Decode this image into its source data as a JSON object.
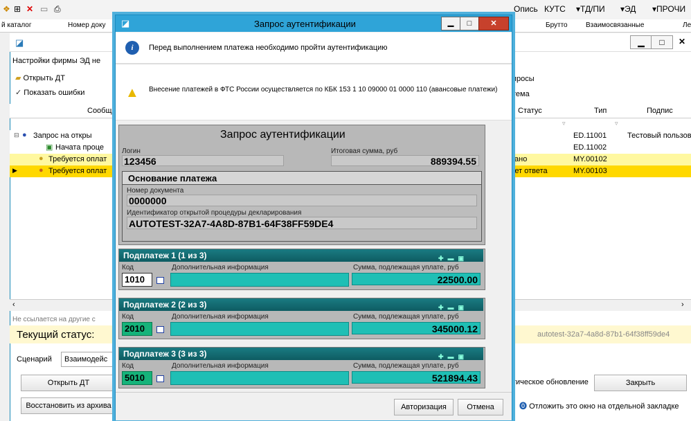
{
  "app": {
    "toolbar_items": [
      "Опись",
      "КУТС",
      "▾ТД/ПИ",
      "▾ЭД",
      "▾ПРОЧИ"
    ],
    "column_headers": [
      "й каталог",
      "Номер доку",
      "Брутто",
      "Взаимосвязанные",
      "Ле"
    ],
    "settings_label": "Настройки фирмы ЭД не",
    "actions": [
      "Открыть ДТ",
      "Показать ошибки"
    ],
    "right_actions": [
      "просы",
      "тема"
    ],
    "tree_header": "Сообщ",
    "grid_headers": [
      "Статус",
      "Тип",
      "Подпис"
    ],
    "tree_rows": [
      "Запрос на откры",
      "Начата проце",
      "Требуется оплат",
      "Требуется оплат"
    ],
    "grid_rows": [
      {
        "status": "",
        "type": "ED.11001",
        "sign": "Тестовый пользов"
      },
      {
        "status": "",
        "type": "ED.11002",
        "sign": ""
      },
      {
        "status": "зано",
        "type": "MY.00102",
        "sign": ""
      },
      {
        "status": "ует ответа",
        "type": "MY.00103",
        "sign": ""
      }
    ],
    "links_note": "Не ссылается на другие с",
    "current_status_label": "Текущий статус:",
    "current_status_value": "autotest-32a7-4a8d-87b1-64f38ff59de4",
    "scenario_label": "Сценарий",
    "scenario_value": "Взаимодейс",
    "open_dt_button": "Открыть ДТ",
    "auto_update_label": "тическое обновление",
    "close_button": "Закрыть",
    "restore_button": "Восстановить из архива",
    "defer_label": "Отложить это окно на отдельной закладке"
  },
  "dialog": {
    "title": "Запрос аутентификации",
    "info_message": "Перед выполнением платежа необходимо пройти аутентификацию",
    "warning_message": "Внесение платежей в ФТС России осуществляется по КБК 153 1 10 09000 01 0000 110 (авансовые платежи)",
    "panel_title": "Запрос аутентификации",
    "login_label": "Логин",
    "login_value": "123456",
    "total_label": "Итоговая сумма, руб",
    "total_value": "889394.55",
    "basis_title": "Основание платежа",
    "doc_number_label": "Номер документа",
    "doc_number_value": "0000000",
    "procedure_id_label": "Идентификатор открытой процедуры декларирования",
    "procedure_id_value": "AUTOTEST-32A7-4A8D-87B1-64F38FF59DE4",
    "subpayments": [
      {
        "title": "Подплатеж 1 (1 из 3)",
        "code_label": "Код",
        "info_label": "Дополнительная информация",
        "sum_label": "Сумма, подлежащая уплате, руб",
        "code": "1010",
        "sum": "22500.00"
      },
      {
        "title": "Подплатеж 2 (2 из 3)",
        "code_label": "Код",
        "info_label": "Дополнительная информация",
        "sum_label": "Сумма, подлежащая уплате, руб",
        "code": "2010",
        "sum": "345000.12"
      },
      {
        "title": "Подплатеж 3 (3 из 3)",
        "code_label": "Код",
        "info_label": "Дополнительная информация",
        "sum_label": "Сумма, подлежащая уплате, руб",
        "code": "5010",
        "sum": "521894.43"
      }
    ],
    "auth_button": "Авторизация",
    "cancel_button": "Отмена"
  }
}
